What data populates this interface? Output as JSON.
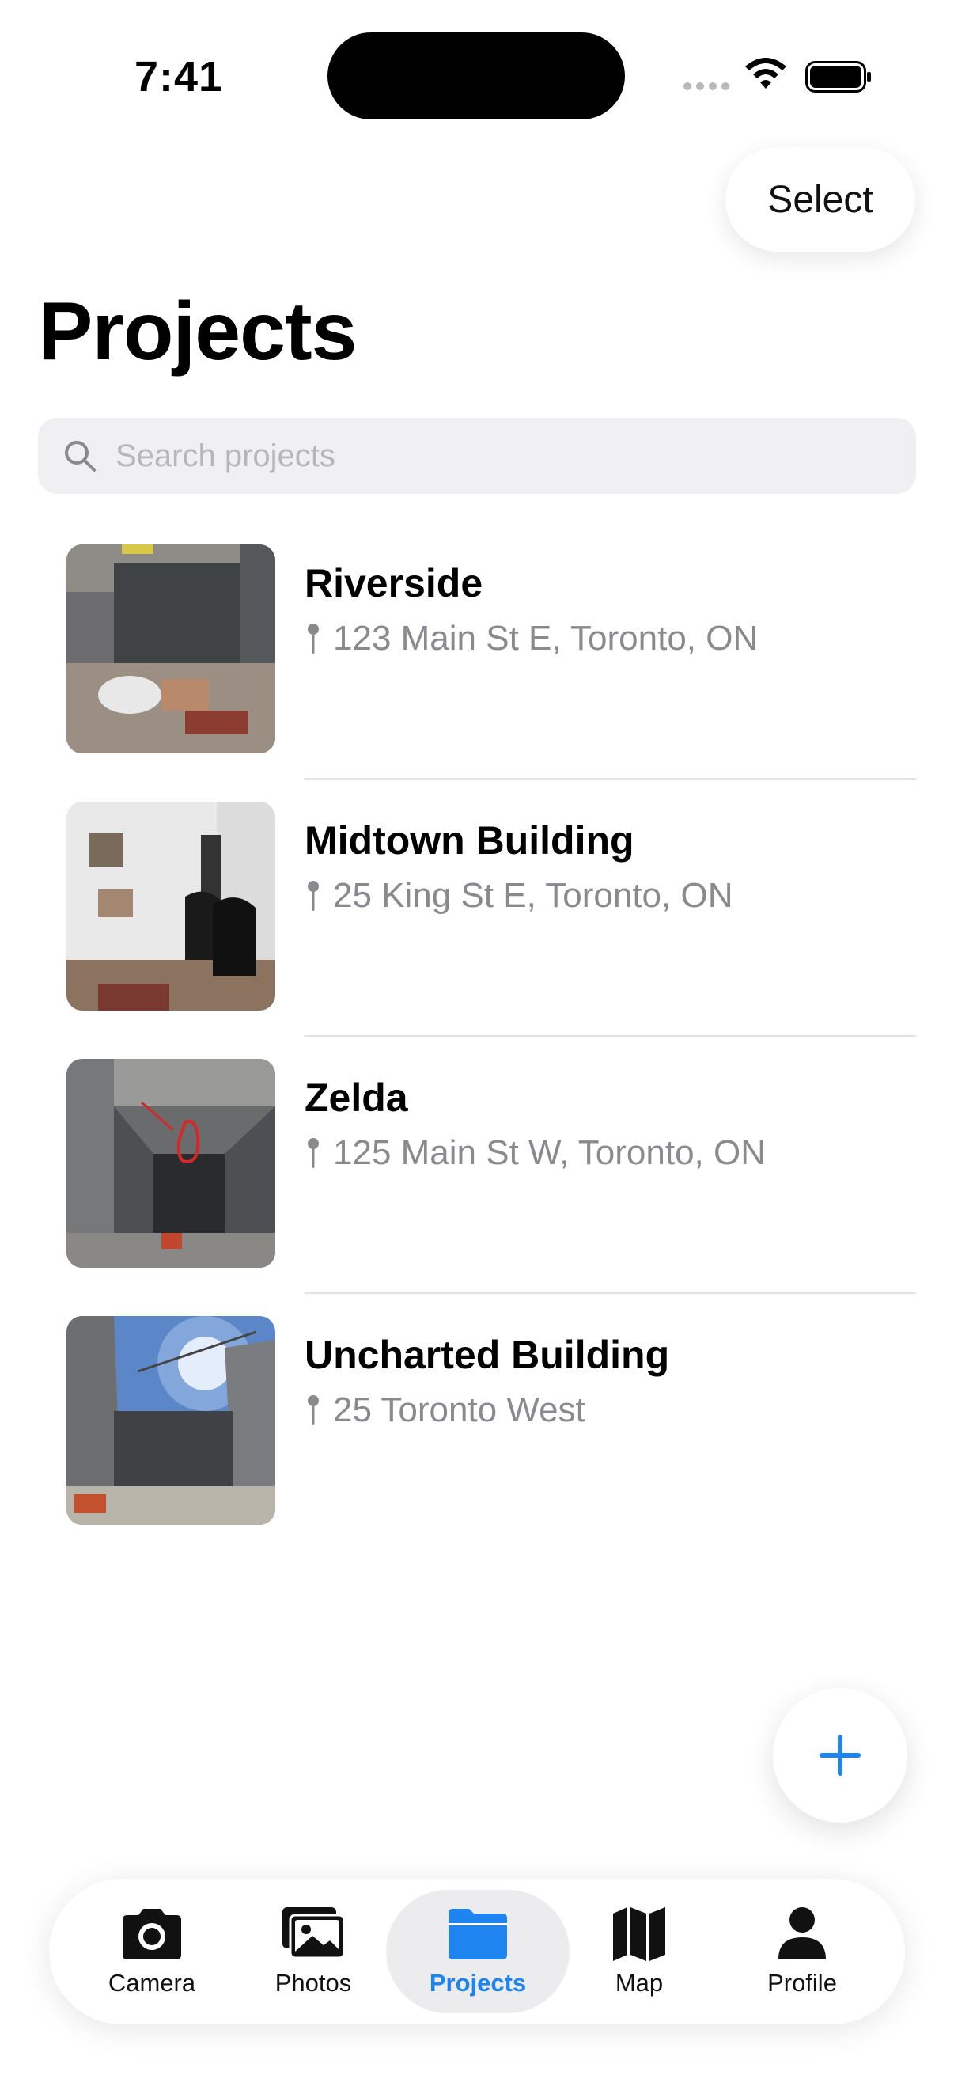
{
  "status_bar": {
    "time": "7:41"
  },
  "header": {
    "select_label": "Select",
    "title": "Projects"
  },
  "search": {
    "placeholder": "Search projects",
    "value": ""
  },
  "projects": [
    {
      "name": "Riverside",
      "address": "123 Main St E, Toronto, ON"
    },
    {
      "name": "Midtown Building",
      "address": "25 King St E, Toronto, ON"
    },
    {
      "name": "Zelda",
      "address": "125 Main St W, Toronto, ON"
    },
    {
      "name": "Uncharted Building",
      "address": "25 Toronto West"
    }
  ],
  "fab": {
    "icon": "plus-icon"
  },
  "tab_bar": {
    "active": "Projects",
    "items": [
      {
        "label": "Camera",
        "icon": "camera-icon"
      },
      {
        "label": "Photos",
        "icon": "photos-icon"
      },
      {
        "label": "Projects",
        "icon": "folder-icon"
      },
      {
        "label": "Map",
        "icon": "map-icon"
      },
      {
        "label": "Profile",
        "icon": "person-icon"
      }
    ]
  },
  "colors": {
    "accent": "#1d84f0",
    "secondary_text": "#8a8a8e",
    "search_bg": "#f0f0f3"
  }
}
